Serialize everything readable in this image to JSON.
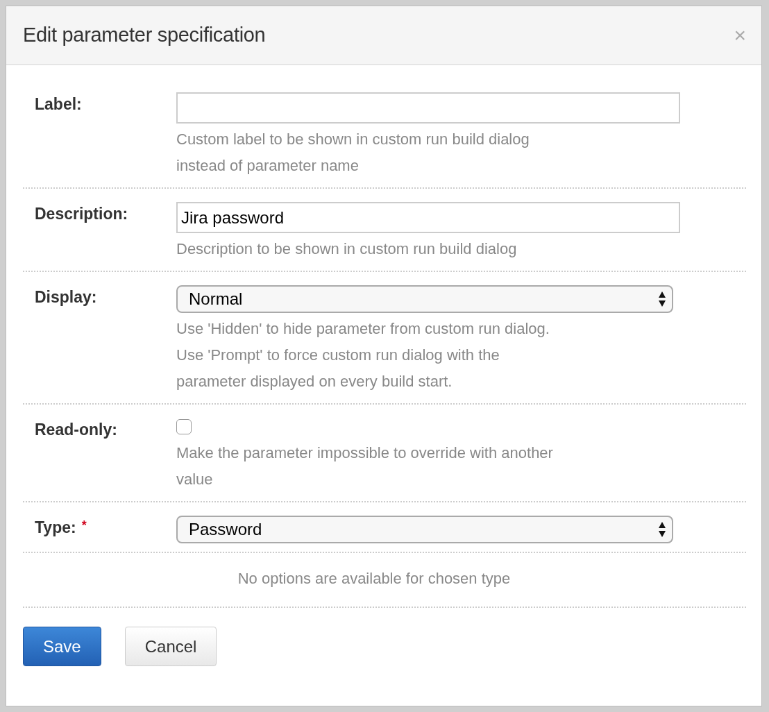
{
  "dialog": {
    "title": "Edit parameter specification",
    "close": "×"
  },
  "fields": [
    {
      "kind": "text",
      "label": "Label:",
      "required": false,
      "help": [
        "Custom label to be shown in custom run build dialog instead of parameter name"
      ]
    },
    {
      "kind": "text",
      "label": "Description:",
      "required": false,
      "value": "Jira password",
      "help": [
        "Description to be shown in custom run build dialog"
      ]
    },
    {
      "kind": "select",
      "label": "Display:",
      "required": false,
      "value": "Normal",
      "help": [
        "Use 'Hidden' to hide parameter from custom run dialog.",
        "Use 'Prompt' to force custom run dialog with the parameter displayed on every build start."
      ]
    },
    {
      "kind": "checkbox",
      "label": "Read-only:",
      "required": false,
      "checked": false,
      "help": [
        "Make the parameter impossible to override with another value"
      ]
    },
    {
      "kind": "select",
      "label": "Type:",
      "required": true,
      "value": "Password"
    }
  ],
  "required_marker": "*",
  "note": "No options are available for chosen type",
  "buttons": [
    {
      "label": "Save",
      "kind": "primary"
    },
    {
      "label": "Cancel",
      "kind": "default"
    }
  ]
}
